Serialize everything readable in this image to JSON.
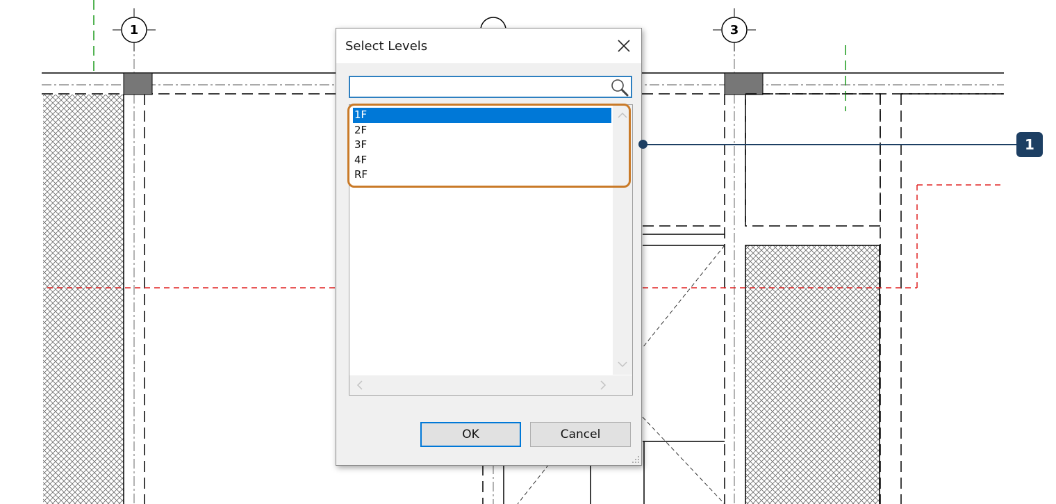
{
  "drawing": {
    "grid_labels": [
      "1",
      "3"
    ]
  },
  "dialog": {
    "title": "Select Levels",
    "search": {
      "value": "",
      "placeholder": ""
    },
    "levels": [
      "1F",
      "2F",
      "3F",
      "4F",
      "RF"
    ],
    "selected_level": "1F",
    "ok_label": "OK",
    "cancel_label": "Cancel"
  },
  "callout": {
    "number": "1"
  },
  "colors": {
    "selection": "#0078d7",
    "highlight_border": "#c97a28",
    "callout": "#1d3f63",
    "section_line": "#e02020",
    "grid_green": "#1a9a1a"
  },
  "icons": {
    "close": "close-icon",
    "search": "search-icon",
    "scroll_up": "chevron-up-icon",
    "scroll_down": "chevron-down-icon",
    "scroll_left": "chevron-left-icon",
    "scroll_right": "chevron-right-icon",
    "grip": "resize-grip-icon"
  }
}
